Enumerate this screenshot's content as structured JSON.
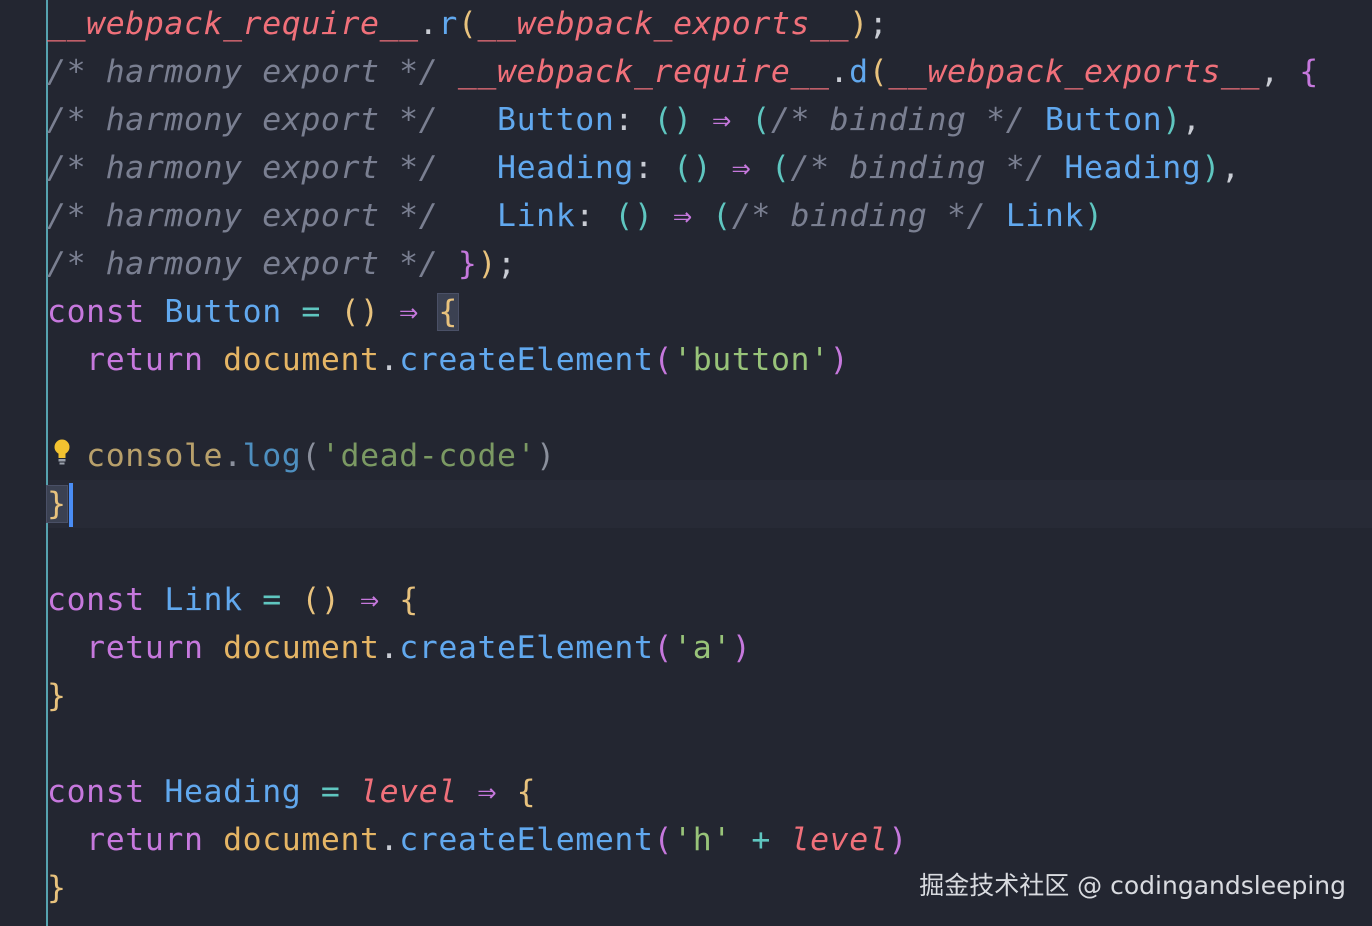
{
  "editor": {
    "lines": [
      [
        {
          "t": "__webpack_require__",
          "c": "t-req"
        },
        {
          "t": ".",
          "c": "t-punc"
        },
        {
          "t": "r",
          "c": "t-fn"
        },
        {
          "t": "(",
          "c": "t-br1"
        },
        {
          "t": "__webpack_exports__",
          "c": "t-req"
        },
        {
          "t": ")",
          "c": "t-br1"
        },
        {
          "t": ";",
          "c": "t-punc"
        }
      ],
      [
        {
          "t": "/* harmony export */ ",
          "c": "t-cmt"
        },
        {
          "t": "__webpack_require__",
          "c": "t-req"
        },
        {
          "t": ".",
          "c": "t-punc"
        },
        {
          "t": "d",
          "c": "t-fn"
        },
        {
          "t": "(",
          "c": "t-br1"
        },
        {
          "t": "__webpack_exports__",
          "c": "t-req"
        },
        {
          "t": ", ",
          "c": "t-punc"
        },
        {
          "t": "{",
          "c": "t-br2"
        }
      ],
      [
        {
          "t": "/* harmony export */   ",
          "c": "t-cmt"
        },
        {
          "t": "Button",
          "c": "t-id"
        },
        {
          "t": ": ",
          "c": "t-punc"
        },
        {
          "t": "()",
          "c": "t-br3"
        },
        {
          "t": " ⇒ ",
          "c": "t-arrow"
        },
        {
          "t": "(",
          "c": "t-br3"
        },
        {
          "t": "/* binding */ ",
          "c": "t-cmt"
        },
        {
          "t": "Button",
          "c": "t-id"
        },
        {
          "t": ")",
          "c": "t-br3"
        },
        {
          "t": ",",
          "c": "t-punc"
        }
      ],
      [
        {
          "t": "/* harmony export */   ",
          "c": "t-cmt"
        },
        {
          "t": "Heading",
          "c": "t-id"
        },
        {
          "t": ": ",
          "c": "t-punc"
        },
        {
          "t": "()",
          "c": "t-br3"
        },
        {
          "t": " ⇒ ",
          "c": "t-arrow"
        },
        {
          "t": "(",
          "c": "t-br3"
        },
        {
          "t": "/* binding */ ",
          "c": "t-cmt"
        },
        {
          "t": "Heading",
          "c": "t-id"
        },
        {
          "t": ")",
          "c": "t-br3"
        },
        {
          "t": ",",
          "c": "t-punc"
        }
      ],
      [
        {
          "t": "/* harmony export */   ",
          "c": "t-cmt"
        },
        {
          "t": "Link",
          "c": "t-id"
        },
        {
          "t": ": ",
          "c": "t-punc"
        },
        {
          "t": "()",
          "c": "t-br3"
        },
        {
          "t": " ⇒ ",
          "c": "t-arrow"
        },
        {
          "t": "(",
          "c": "t-br3"
        },
        {
          "t": "/* binding */ ",
          "c": "t-cmt"
        },
        {
          "t": "Link",
          "c": "t-id"
        },
        {
          "t": ")",
          "c": "t-br3"
        }
      ],
      [
        {
          "t": "/* harmony export */ ",
          "c": "t-cmt"
        },
        {
          "t": "}",
          "c": "t-br2"
        },
        {
          "t": ")",
          "c": "t-br1"
        },
        {
          "t": ";",
          "c": "t-punc"
        }
      ],
      [
        {
          "t": "const ",
          "c": "t-kw"
        },
        {
          "t": "Button",
          "c": "t-id"
        },
        {
          "t": " = ",
          "c": "t-op"
        },
        {
          "t": "()",
          "c": "t-br1"
        },
        {
          "t": " ⇒ ",
          "c": "t-arrow"
        },
        {
          "t": "{",
          "c": "t-br1 match-brace"
        }
      ],
      [
        {
          "t": "  return ",
          "c": "t-kw"
        },
        {
          "t": "document",
          "c": "t-obj"
        },
        {
          "t": ".",
          "c": "t-punc"
        },
        {
          "t": "createElement",
          "c": "t-fn"
        },
        {
          "t": "(",
          "c": "t-br2"
        },
        {
          "t": "'button'",
          "c": "t-str"
        },
        {
          "t": ")",
          "c": "t-br2"
        }
      ],
      [],
      [
        {
          "t": "  console",
          "c": "t-dead-obj"
        },
        {
          "t": ".",
          "c": "t-dead-punc"
        },
        {
          "t": "log",
          "c": "t-dead-fn"
        },
        {
          "t": "(",
          "c": "t-dead-punc"
        },
        {
          "t": "'dead-code'",
          "c": "t-dead-str"
        },
        {
          "t": ")",
          "c": "t-dead-punc"
        }
      ],
      [
        {
          "t": "}",
          "c": "t-br1 match-brace"
        }
      ],
      [],
      [
        {
          "t": "const ",
          "c": "t-kw"
        },
        {
          "t": "Link",
          "c": "t-id"
        },
        {
          "t": " = ",
          "c": "t-op"
        },
        {
          "t": "()",
          "c": "t-br1"
        },
        {
          "t": " ⇒ ",
          "c": "t-arrow"
        },
        {
          "t": "{",
          "c": "t-br1"
        }
      ],
      [
        {
          "t": "  return ",
          "c": "t-kw"
        },
        {
          "t": "document",
          "c": "t-obj"
        },
        {
          "t": ".",
          "c": "t-punc"
        },
        {
          "t": "createElement",
          "c": "t-fn"
        },
        {
          "t": "(",
          "c": "t-br2"
        },
        {
          "t": "'a'",
          "c": "t-str"
        },
        {
          "t": ")",
          "c": "t-br2"
        }
      ],
      [
        {
          "t": "}",
          "c": "t-br1"
        }
      ],
      [],
      [
        {
          "t": "const ",
          "c": "t-kw"
        },
        {
          "t": "Heading",
          "c": "t-id"
        },
        {
          "t": " = ",
          "c": "t-op"
        },
        {
          "t": "level",
          "c": "t-param"
        },
        {
          "t": " ⇒ ",
          "c": "t-arrow"
        },
        {
          "t": "{",
          "c": "t-br1"
        }
      ],
      [
        {
          "t": "  return ",
          "c": "t-kw"
        },
        {
          "t": "document",
          "c": "t-obj"
        },
        {
          "t": ".",
          "c": "t-punc"
        },
        {
          "t": "createElement",
          "c": "t-fn"
        },
        {
          "t": "(",
          "c": "t-br2"
        },
        {
          "t": "'h'",
          "c": "t-str"
        },
        {
          "t": " + ",
          "c": "t-op"
        },
        {
          "t": "level",
          "c": "t-param"
        },
        {
          "t": ")",
          "c": "t-br2"
        }
      ],
      [
        {
          "t": "}",
          "c": "t-br1"
        }
      ]
    ],
    "cursor_line": 10,
    "bulb_line": 9,
    "bulb_icon": "lightbulb-icon"
  },
  "watermark": "掘金技术社区 @ codingandsleeping",
  "colors": {
    "background": "#232631",
    "gutter_rule": "#5fb8c6",
    "cursor": "#4a8df5"
  }
}
